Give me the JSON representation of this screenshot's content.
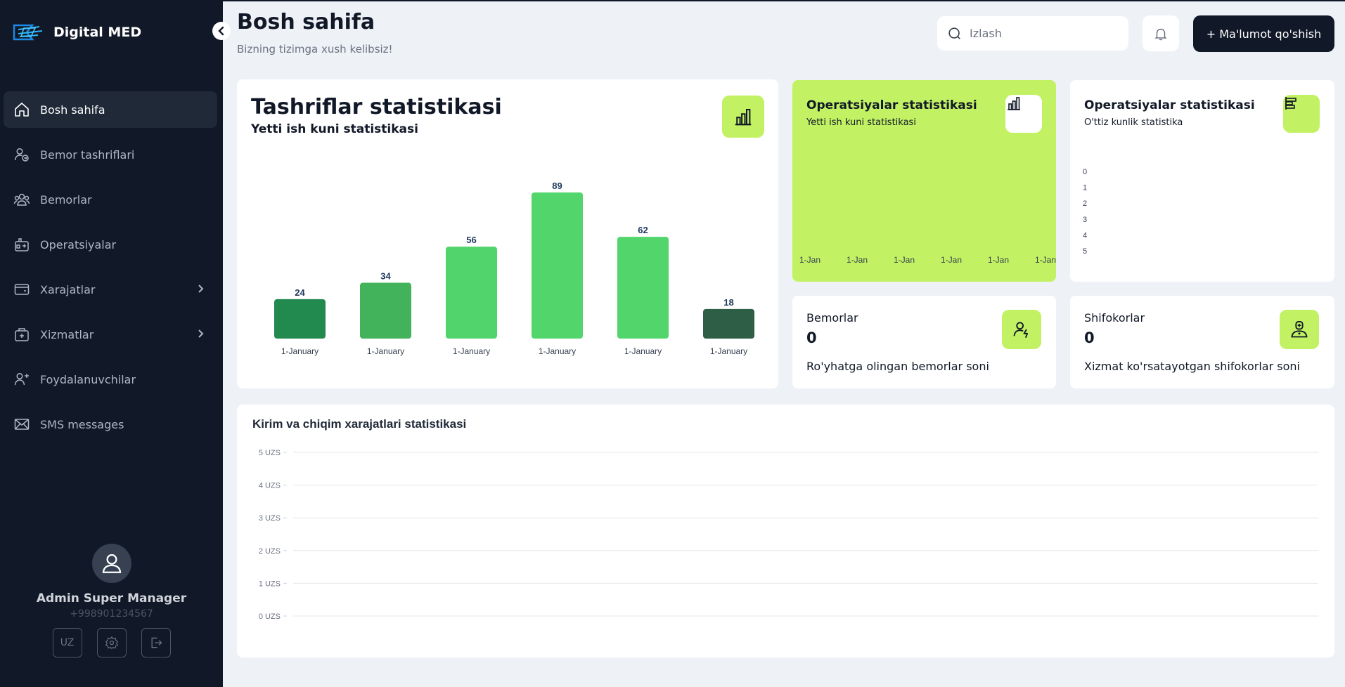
{
  "app": {
    "name": "Digital MED"
  },
  "sidebar": {
    "items": [
      {
        "label": "Bosh sahifa",
        "icon": "home-icon",
        "active": true
      },
      {
        "label": "Bemor tashriflari",
        "icon": "user-visit-icon"
      },
      {
        "label": "Bemorlar",
        "icon": "users-icon"
      },
      {
        "label": "Operatsiyalar",
        "icon": "medical-kit-icon"
      },
      {
        "label": "Xarajatlar",
        "icon": "wallet-icon",
        "submenu": true
      },
      {
        "label": "Xizmatlar",
        "icon": "briefcase-medical-icon",
        "submenu": true
      },
      {
        "label": "Foydalanuvchilar",
        "icon": "user-add-icon"
      },
      {
        "label": "SMS messages",
        "icon": "mail-icon"
      }
    ]
  },
  "profile": {
    "name": "Admin Super Manager",
    "phone": "+998901234567",
    "lang": "UZ"
  },
  "header": {
    "title": "Bosh sahifa",
    "subtitle": "Bizning tizimga xush kelibsiz!",
    "search_placeholder": "Izlash",
    "add_button": "+ Ma'lumot qo'shish"
  },
  "visits_card": {
    "title": "Tashriflar statistikasi",
    "subtitle": "Yetti ish kuni statistikasi"
  },
  "ops_card_1": {
    "title": "Operatsiyalar statistikasi",
    "subtitle": "Yetti ish kuni statistikasi"
  },
  "ops_card_2": {
    "title": "Operatsiyalar statistikasi",
    "subtitle": "O'ttiz kunlik statistika"
  },
  "patients_card": {
    "label": "Bemorlar",
    "value": "0",
    "description": "Ro'yhatga olingan bemorlar soni"
  },
  "doctors_card": {
    "label": "Shifokorlar",
    "value": "0",
    "description": "Xizmat ko'rsatayotgan shifokorlar soni"
  },
  "finance_card": {
    "title": "Kirim va chiqim xarajatlari statistikasi"
  },
  "colors": {
    "sidebar_bg": "#111827",
    "accent_lime": "#c2f263",
    "bar_colors": [
      "#22894f",
      "#42b35a",
      "#52d46c",
      "#52d66c",
      "#52d66c",
      "#2f5e46"
    ]
  },
  "chart_data": [
    {
      "type": "bar",
      "categories": [
        "1-January",
        "1-January",
        "1-January",
        "1-January",
        "1-January",
        "1-January"
      ],
      "values": [
        24,
        34,
        56,
        89,
        62,
        18
      ],
      "title": "Tashriflar statistikasi"
    },
    {
      "type": "line",
      "x": [
        "1-Jan",
        "1-Jan",
        "1-Jan",
        "1-Jan",
        "1-Jan",
        "1-Jan"
      ],
      "series": [],
      "title": "Operatsiyalar statistikasi"
    },
    {
      "type": "bar",
      "y_ticks": [
        "0",
        "1",
        "2",
        "3",
        "4",
        "5"
      ],
      "series": [],
      "title": "Operatsiyalar statistikasi"
    },
    {
      "type": "line",
      "y_ticks": [
        "5 UZS",
        "4 UZS",
        "3 UZS",
        "2 UZS",
        "1 UZS",
        "0 UZS"
      ],
      "ylim": [
        0,
        5
      ],
      "grid": true,
      "series": [],
      "title": "Kirim va chiqim xarajatlari statistikasi"
    }
  ]
}
